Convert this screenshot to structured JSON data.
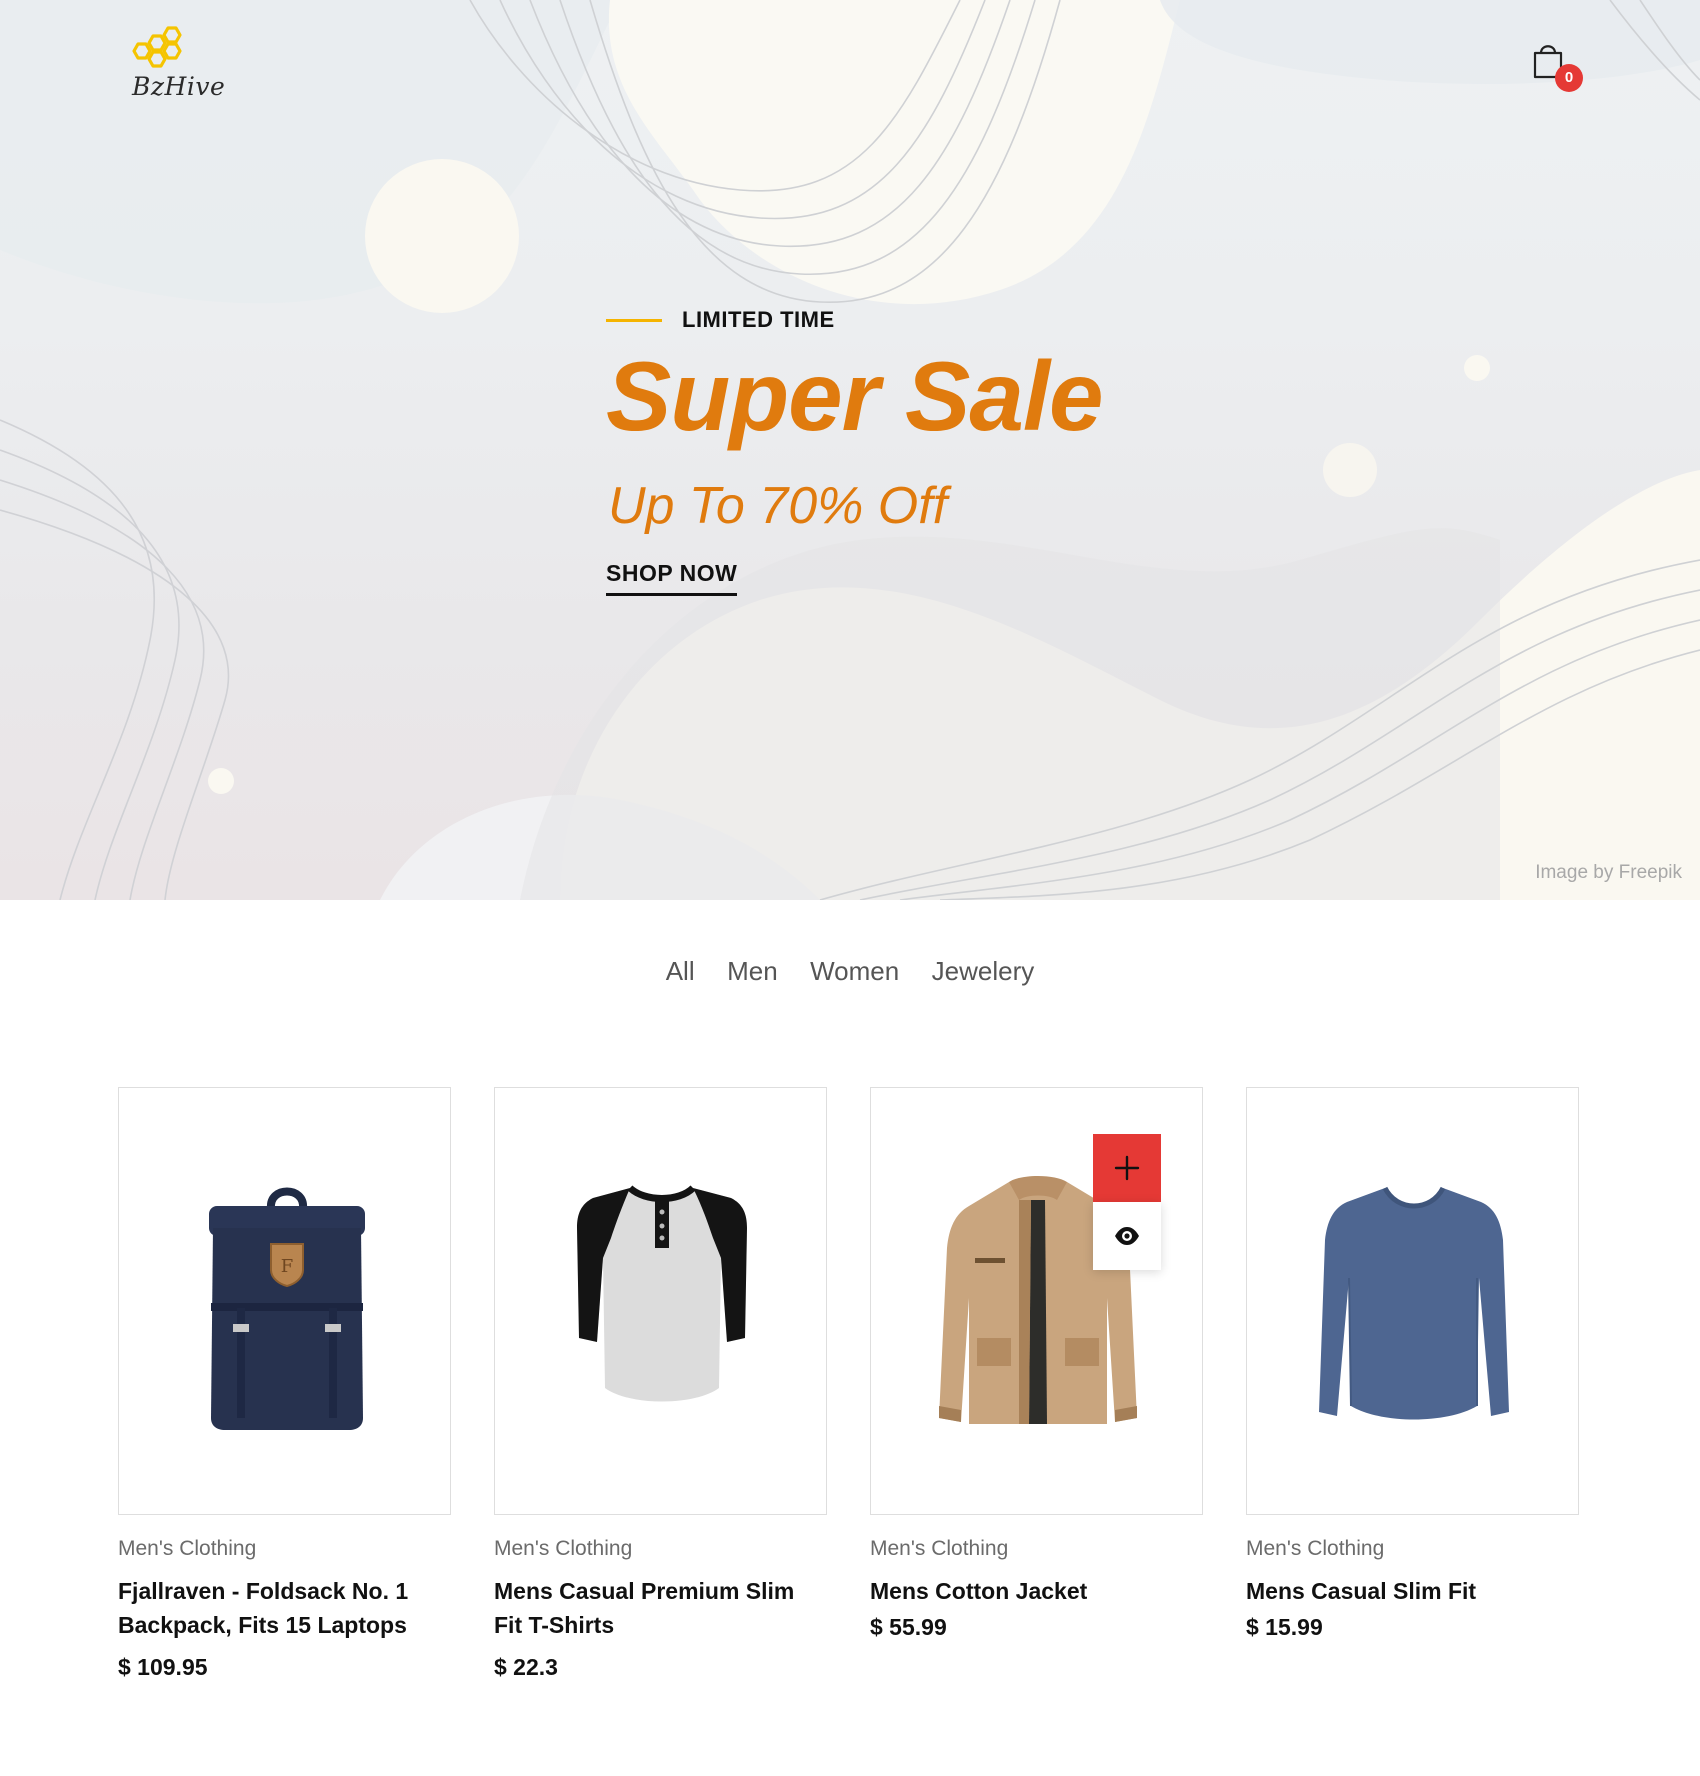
{
  "header": {
    "logo_text": "BzHive",
    "cart_count": "0",
    "logo_color": "#f5c400"
  },
  "hero": {
    "kicker": "LIMITED TIME",
    "headline": "Super Sale",
    "subline": "Up To 70% Off",
    "cta": "SHOP NOW",
    "credit": "Image by Freepik",
    "accent_color": "#e07b0e"
  },
  "filters": {
    "tabs": [
      "All",
      "Men",
      "Women",
      "Jewelery"
    ]
  },
  "products": [
    {
      "category": "Men's Clothing",
      "title": "Fjallraven - Foldsack No. 1 Backpack, Fits 15 Laptops",
      "price": "$ 109.95",
      "image_icon": "backpack-icon"
    },
    {
      "category": "Men's Clothing",
      "title": "Mens Casual Premium Slim Fit T-Shirts",
      "price": "$ 22.3",
      "image_icon": "raglan-tshirt-icon"
    },
    {
      "category": "Men's Clothing",
      "title": "Mens Cotton Jacket",
      "price": "$ 55.99",
      "image_icon": "jacket-icon"
    },
    {
      "category": "Men's Clothing",
      "title": "Mens Casual Slim Fit",
      "price": "$ 15.99",
      "image_icon": "longsleeve-shirt-icon"
    }
  ],
  "product_actions": {
    "add_icon": "plus-icon",
    "view_icon": "eye-icon",
    "add_color": "#e53935"
  }
}
